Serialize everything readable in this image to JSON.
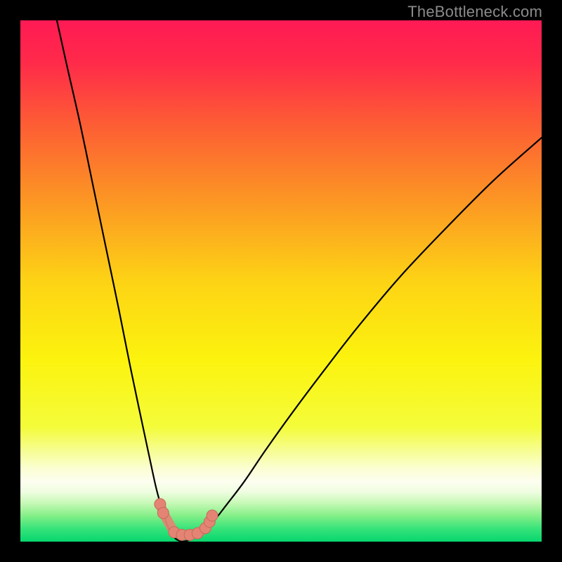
{
  "watermark": "TheBottleneck.com",
  "colors": {
    "background": "#000000",
    "gradient_stops": [
      {
        "pos": 0.0,
        "color": "#ff1a54"
      },
      {
        "pos": 0.08,
        "color": "#ff2a4a"
      },
      {
        "pos": 0.2,
        "color": "#fd5d34"
      },
      {
        "pos": 0.35,
        "color": "#fc9823"
      },
      {
        "pos": 0.5,
        "color": "#fdd315"
      },
      {
        "pos": 0.65,
        "color": "#fcf30e"
      },
      {
        "pos": 0.78,
        "color": "#f4fc3a"
      },
      {
        "pos": 0.825,
        "color": "#f6fd91"
      },
      {
        "pos": 0.86,
        "color": "#fbfed3"
      },
      {
        "pos": 0.885,
        "color": "#fdfef0"
      },
      {
        "pos": 0.905,
        "color": "#eefde0"
      },
      {
        "pos": 0.925,
        "color": "#c9f9b8"
      },
      {
        "pos": 0.95,
        "color": "#85ef88"
      },
      {
        "pos": 0.975,
        "color": "#37e37a"
      },
      {
        "pos": 1.0,
        "color": "#07d66e"
      }
    ],
    "curve_stroke": "#000000",
    "marker_fill": "#e48474",
    "marker_stroke": "#c56a5c"
  },
  "chart_data": {
    "type": "line",
    "title": "",
    "xlabel": "",
    "ylabel": "",
    "xlim": [
      0,
      100
    ],
    "ylim": [
      0,
      100
    ],
    "grid": false,
    "series": [
      {
        "name": "left-branch",
        "x": [
          7.0,
          9.0,
          11.5,
          14.0,
          16.5,
          19.0,
          21.2,
          23.2,
          24.8,
          26.0,
          27.0,
          27.8,
          28.5,
          29.2,
          30.0,
          31.0
        ],
        "y": [
          100.0,
          91.0,
          80.0,
          68.0,
          56.0,
          44.0,
          33.0,
          23.5,
          16.0,
          10.5,
          6.8,
          4.2,
          2.4,
          1.2,
          0.4,
          0.0
        ]
      },
      {
        "name": "right-branch",
        "x": [
          31.0,
          32.5,
          34.5,
          36.8,
          39.5,
          43.0,
          47.0,
          52.0,
          58.0,
          65.0,
          73.0,
          82.0,
          91.0,
          100.0
        ],
        "y": [
          0.0,
          0.3,
          1.4,
          3.6,
          7.0,
          11.6,
          17.5,
          24.5,
          32.5,
          41.5,
          51.0,
          60.5,
          69.5,
          77.5
        ]
      },
      {
        "name": "valley-markers",
        "x": [
          26.8,
          27.4,
          29.5,
          31.0,
          32.5,
          34.0,
          35.5,
          36.3,
          36.8
        ],
        "y": [
          7.2,
          5.5,
          1.8,
          1.3,
          1.3,
          1.6,
          2.6,
          3.8,
          5.0
        ]
      }
    ],
    "annotations": [
      {
        "text": "TheBottleneck.com",
        "x": 98,
        "y": 101,
        "ha": "right"
      }
    ]
  }
}
